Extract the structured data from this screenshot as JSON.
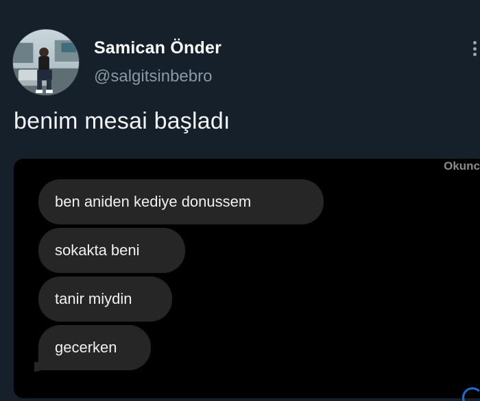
{
  "author": {
    "display_name": "Samican Önder",
    "handle": "@salgitsinbebro",
    "avatar_icon": "profile-photo"
  },
  "header": {
    "more_icon": "more-vertical-icon"
  },
  "tweet": {
    "text": "benim mesai başladı"
  },
  "media": {
    "read_status": "Okunc",
    "messages": [
      "ben aniden kediye donussem",
      "sokakta beni",
      "tanir miydin",
      "gecerken"
    ]
  },
  "colors": {
    "background": "#15202b",
    "chat_background": "#000000",
    "bubble": "#262626",
    "secondary_text": "#8b98a5"
  }
}
